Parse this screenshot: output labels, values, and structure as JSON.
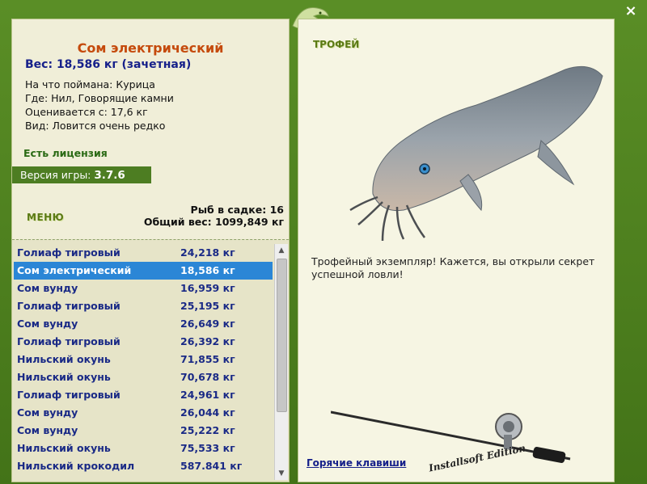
{
  "fish": {
    "title": "Сом электрический",
    "weight": "Вес: 18,586 кг (зачетная)",
    "info": [
      "На что поймана: Курица",
      "Где: Нил, Говорящие камни",
      "Оценивается с: 17,6 кг",
      "Вид: Ловится очень редко"
    ]
  },
  "license": "Есть лицензия",
  "version": {
    "label": "Версия игры:",
    "value": "3.7.6"
  },
  "menu_label": "МЕНЮ",
  "stats": {
    "fish_count": "Рыб в садке: 16",
    "total_weight": "Общий вес: 1099,849 кг"
  },
  "catch_list": [
    {
      "name": "Голиаф тигровый",
      "weight": "24,218 кг"
    },
    {
      "name": "Сом электрический",
      "weight": "18,586 кг",
      "selected": true
    },
    {
      "name": "Сом вунду",
      "weight": "16,959 кг"
    },
    {
      "name": "Голиаф тигровый",
      "weight": "25,195 кг"
    },
    {
      "name": "Сом вунду",
      "weight": "26,649 кг"
    },
    {
      "name": "Голиаф тигровый",
      "weight": "26,392 кг"
    },
    {
      "name": "Нильский окунь",
      "weight": "71,855 кг"
    },
    {
      "name": "Нильский окунь",
      "weight": "70,678 кг"
    },
    {
      "name": "Голиаф тигровый",
      "weight": "24,961 кг"
    },
    {
      "name": "Сом вунду",
      "weight": "26,044 кг"
    },
    {
      "name": "Сом вунду",
      "weight": "25,222 кг"
    },
    {
      "name": "Нильский окунь",
      "weight": "75,533 кг"
    },
    {
      "name": "Нильский крокодил",
      "weight": "587.841 кг"
    }
  ],
  "trophy": {
    "label": "ТРОФЕЙ",
    "text": "Трофейный экземпляр! Кажется, вы открыли секрет успешной ловли!"
  },
  "hotkeys": "Горячие клавиши",
  "edition": "Installsoft Edition",
  "close_icon": "×",
  "colors": {
    "frame": "#4a7a1e",
    "title": "#c54a0c",
    "weight": "#16208a",
    "selected_row": "#2b86d6",
    "license": "#2a6a14"
  }
}
